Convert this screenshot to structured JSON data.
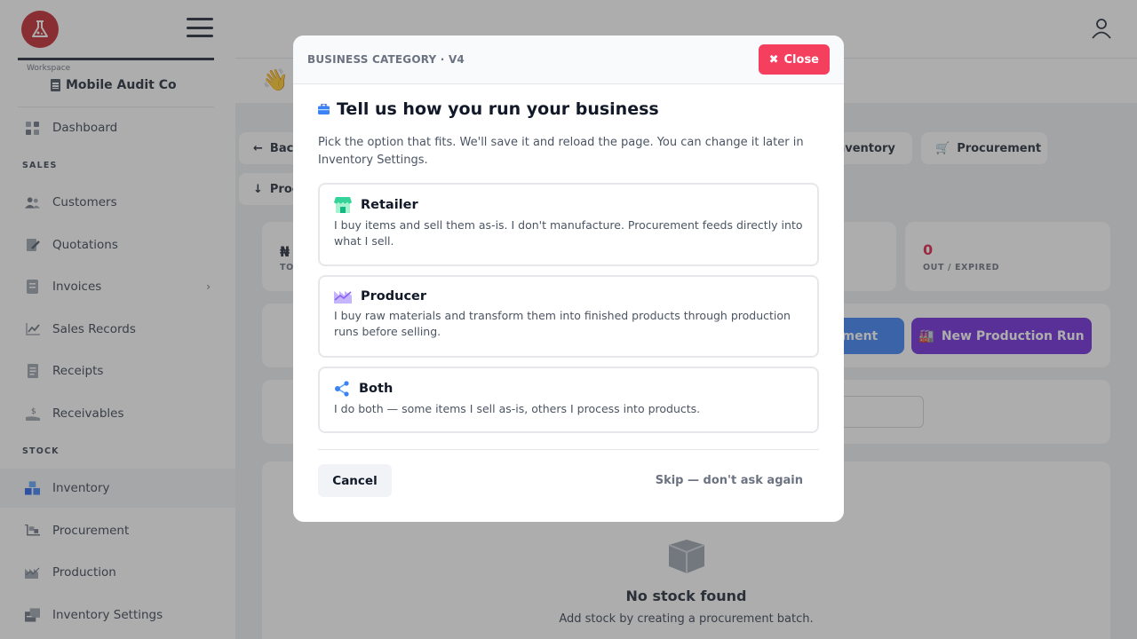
{
  "sidebar": {
    "workspace_label": "Workspace",
    "workspace_name": "Mobile Audit Co",
    "items": [
      {
        "label": "Dashboard",
        "icon": "dashboard-icon"
      },
      {
        "section": "SALES"
      },
      {
        "label": "Customers",
        "icon": "users-icon"
      },
      {
        "label": "Quotations",
        "icon": "quotation-icon"
      },
      {
        "label": "Invoices",
        "icon": "invoice-icon"
      },
      {
        "label": "Sales Records",
        "icon": "chart-line-icon"
      },
      {
        "label": "Receipts",
        "icon": "receipt-icon"
      },
      {
        "label": "Receivables",
        "icon": "receivables-icon"
      },
      {
        "section": "STOCK"
      },
      {
        "label": "Inventory",
        "icon": "boxes-icon"
      },
      {
        "label": "Procurement",
        "icon": "procurement-icon"
      },
      {
        "label": "Production",
        "icon": "factory-icon"
      },
      {
        "label": "Inventory Settings",
        "icon": "settings-box-icon"
      }
    ],
    "labels": {
      "dashboard": "Dashboard",
      "sales_section": "SALES",
      "customers": "Customers",
      "quotations": "Quotations",
      "invoices": "Invoices",
      "sales_records": "Sales Records",
      "receipts": "Receipts",
      "receivables": "Receivables",
      "stock_section": "STOCK",
      "inventory": "Inventory",
      "procurement": "Procurement",
      "production": "Production",
      "inventory_settings": "Inventory Settings"
    }
  },
  "background": {
    "back_label": "Bac",
    "prod_label": "Proc",
    "inventory_tab": "nventory",
    "procurement_tab": "Procurement",
    "stat_left_value": "₦",
    "stat_left_label": "TO",
    "stat_right_value": "0",
    "stat_right_label": "OUT / EXPIRED",
    "btn_blue_label": "ement",
    "btn_purple_label": "New Production Run",
    "empty_title": "No stock found",
    "empty_sub": "Add stock by creating a procurement batch."
  },
  "modal": {
    "kicker": "BUSINESS CATEGORY · V4",
    "close_label": "Close",
    "title": "Tell us how you run your business",
    "description": "Pick the option that fits. We'll save it and reload the page. You can change it later in Inventory Settings.",
    "options": [
      {
        "title": "Retailer",
        "description": "I buy items and sell them as-is. I don't manufacture. Procurement feeds directly into what I sell.",
        "icon": "store-icon"
      },
      {
        "title": "Producer",
        "description": "I buy raw materials and transform them into finished products through production runs before selling.",
        "icon": "factory-icon"
      },
      {
        "title": "Both",
        "description": "I do both — some items I sell as-is, others I process into products.",
        "icon": "share-nodes-icon"
      }
    ],
    "cancel_label": "Cancel",
    "skip_label": "Skip — don't ask again"
  },
  "colors": {
    "brand": "#c1272d",
    "close_button": "#f43f5e",
    "accent_purple": "#6d28d9",
    "accent_blue": "#3b82f6",
    "danger_text": "#e11d48"
  }
}
